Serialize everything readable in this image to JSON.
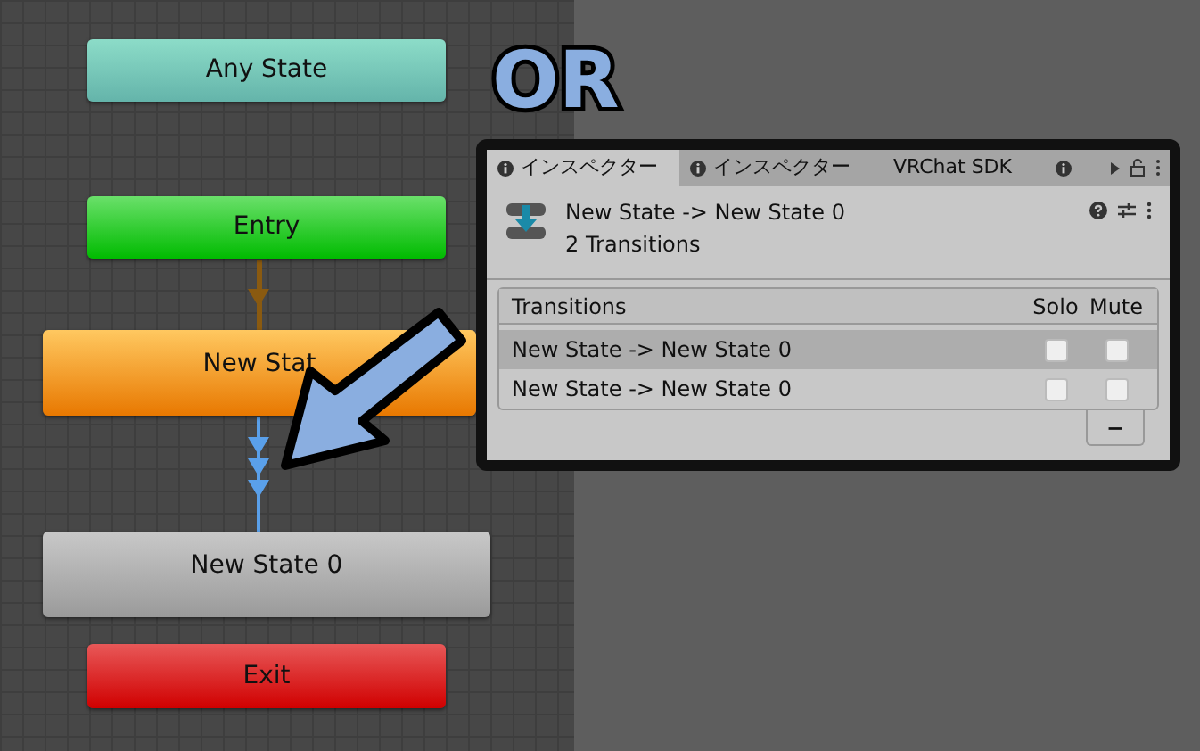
{
  "graph": {
    "nodes": [
      {
        "label": "Any State",
        "kind": "any"
      },
      {
        "label": "Entry",
        "kind": "entry"
      },
      {
        "label": "New Stat",
        "kind": "default"
      },
      {
        "label": "New State 0",
        "kind": "state"
      },
      {
        "label": "Exit",
        "kind": "exit"
      }
    ]
  },
  "callout": {
    "text": "OR"
  },
  "inspector": {
    "tabs": [
      {
        "label": "インスペクター",
        "kind": "info",
        "selected": true
      },
      {
        "label": "インスペクター",
        "kind": "info",
        "selected": false
      },
      {
        "label": "VRChat SDK",
        "kind": "plain",
        "selected": false
      },
      {
        "kind": "info",
        "selected": false
      }
    ],
    "title": "New State -> New State 0",
    "subtitle": "2 Transitions",
    "list": {
      "columns": [
        "Transitions",
        "Solo",
        "Mute"
      ],
      "rows": [
        {
          "name": "New State -> New State 0",
          "selected": true,
          "solo": false,
          "mute": false
        },
        {
          "name": "New State -> New State 0",
          "selected": false,
          "solo": false,
          "mute": false
        }
      ]
    },
    "remove_button": "−"
  }
}
